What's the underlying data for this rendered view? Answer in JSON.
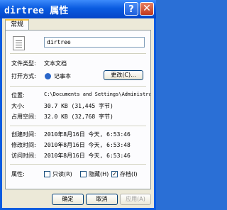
{
  "window": {
    "title": "dirtree 属性",
    "help_glyph": "?",
    "close_glyph": "✕"
  },
  "tabs": [
    {
      "label": "常规"
    }
  ],
  "general": {
    "filename": "dirtree",
    "rows": {
      "type_label": "文件类型:",
      "type_value": "文本文档",
      "opens_label": "打开方式:",
      "opens_value": "记事本",
      "change_button": "更改(C)...",
      "location_label": "位置:",
      "location_value": "C:\\Documents and Settings\\Administrator\\D",
      "size_label": "大小:",
      "size_value": "30.7 KB (31,445 字节)",
      "disk_label": "占用空间:",
      "disk_value": "32.0 KB (32,768 字节)",
      "created_label": "创建时间:",
      "created_value": "2010年8月16日 今天, 6:53:46",
      "modified_label": "修改时间:",
      "modified_value": "2010年8月16日 今天, 6:53:48",
      "accessed_label": "访问时间:",
      "accessed_value": "2010年8月16日 今天, 6:53:46",
      "attributes_label": "属性:"
    },
    "attributes": [
      {
        "label": "只读(R)",
        "checked": false
      },
      {
        "label": "隐藏(H)",
        "checked": false
      },
      {
        "label": "存档(I)",
        "checked": true
      }
    ]
  },
  "footer": {
    "ok": "确定",
    "cancel": "取消",
    "apply": "应用(A)"
  }
}
